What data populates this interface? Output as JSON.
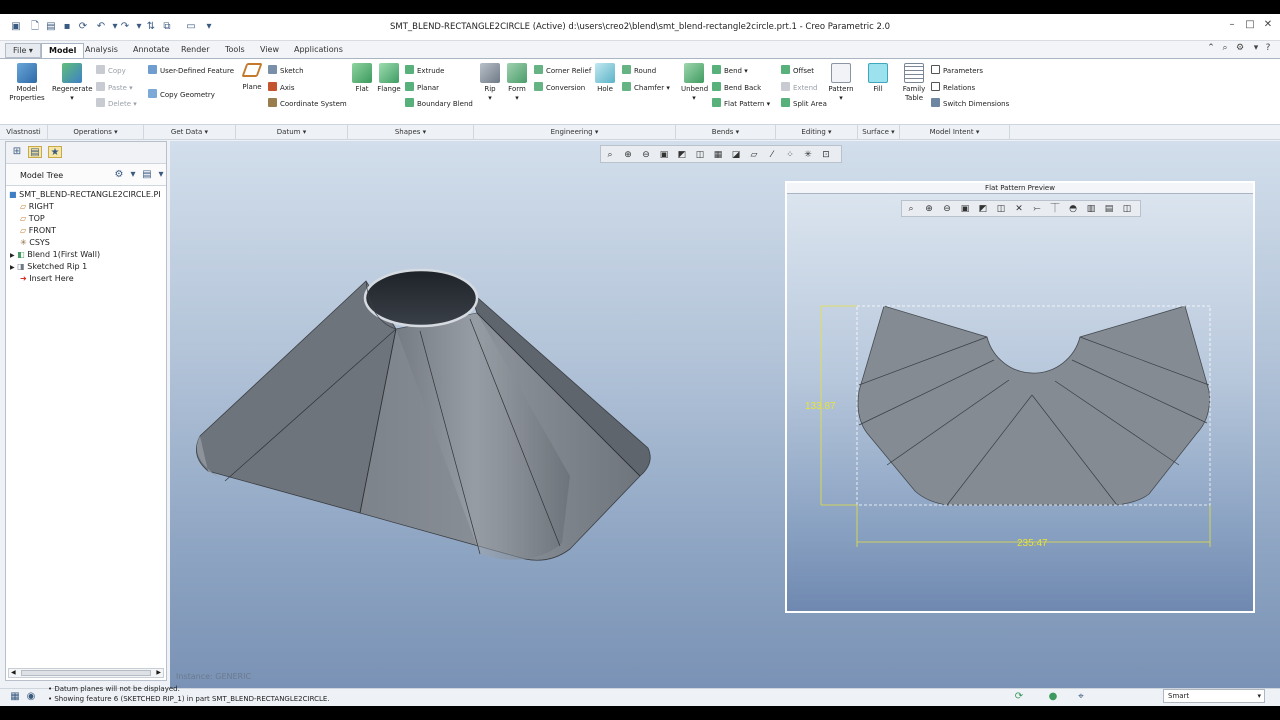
{
  "window": {
    "title": "SMT_BLEND-RECTANGLE2CIRCLE (Active) d:\\users\\creo2\\blend\\smt_blend-rectangle2circle.prt.1 - Creo Parametric 2.0"
  },
  "tabs": [
    "File",
    "Model",
    "Analysis",
    "Annotate",
    "Render",
    "Tools",
    "View",
    "Applications"
  ],
  "ribbon": {
    "model_properties": "Model Properties",
    "regenerate": "Regenerate",
    "copy": "Copy",
    "paste": "Paste",
    "delete": "Delete",
    "user_defined_feature": "User-Defined Feature",
    "copy_geometry": "Copy Geometry",
    "plane": "Plane",
    "sketch": "Sketch",
    "axis": "Axis",
    "coordinate_system": "Coordinate System",
    "flat": "Flat",
    "flange": "Flange",
    "extrude": "Extrude",
    "planar": "Planar",
    "boundary_blend": "Boundary Blend",
    "rip": "Rip",
    "form": "Form",
    "corner_relief": "Corner Relief",
    "conversion": "Conversion",
    "hole": "Hole",
    "round": "Round",
    "chamfer": "Chamfer",
    "unbend": "Unbend",
    "bend": "Bend",
    "bend_back": "Bend Back",
    "flat_pattern": "Flat Pattern",
    "offset": "Offset",
    "extend": "Extend",
    "split_area": "Split Area",
    "pattern": "Pattern",
    "fill": "Fill",
    "family_table": "Family Table",
    "parameters": "Parameters",
    "relations": "Relations",
    "switch_dimensions": "Switch Dimensions"
  },
  "groups": [
    "Vlastnosti",
    "Operations",
    "Get Data",
    "Datum",
    "Shapes",
    "Engineering",
    "Bends",
    "Editing",
    "Surface",
    "Model Intent"
  ],
  "model_tree": {
    "header": "Model Tree",
    "items": [
      "SMT_BLEND-RECTANGLE2CIRCLE.PI",
      "RIGHT",
      "TOP",
      "FRONT",
      "CSYS",
      "Blend 1(First Wall)",
      "Sketched Rip 1",
      "Insert Here"
    ]
  },
  "viewport": {
    "instance_label": "Instance: GENERIC"
  },
  "flat_pattern_preview": {
    "title": "Flat Pattern Preview",
    "dim_height": "133.87",
    "dim_width": "235.47"
  },
  "status": {
    "messages": [
      "Datum planes will not be displayed.",
      "Showing feature 6 (SKETCHED RIP_1) in part SMT_BLEND-RECTANGLE2CIRCLE."
    ],
    "filter": "Smart"
  },
  "colors": {
    "accent": "#3a6fb0",
    "dimension": "#e8e23a",
    "part": "#6d747c"
  }
}
